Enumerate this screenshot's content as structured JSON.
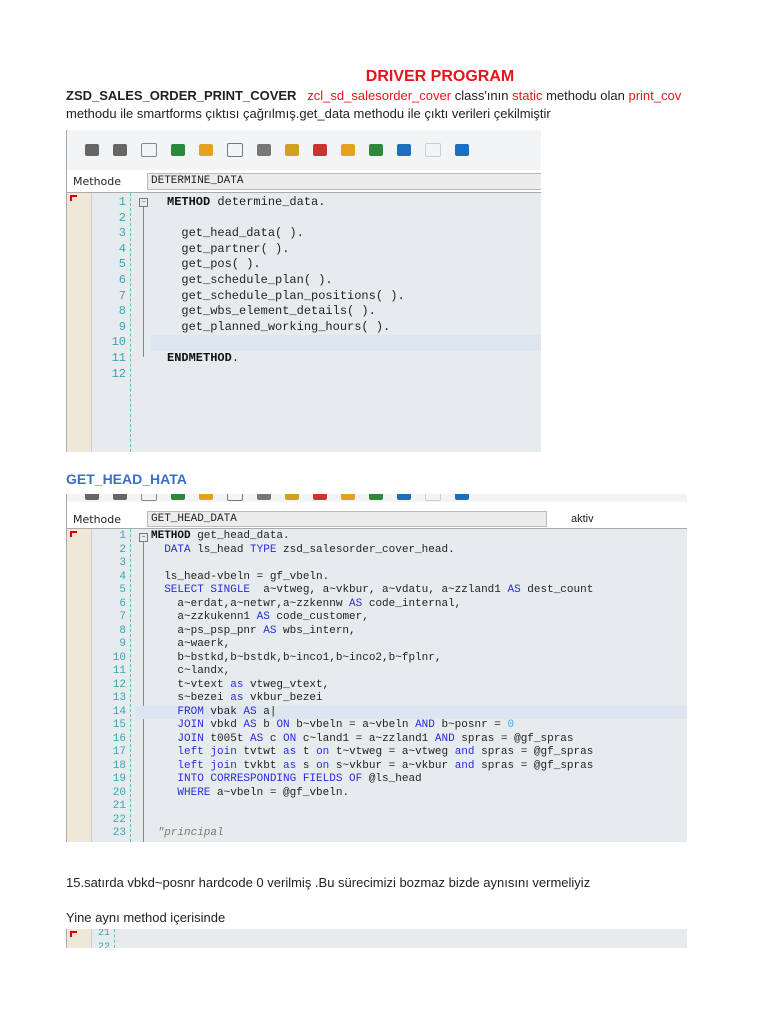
{
  "title": "DRIVER PROGRAM",
  "intro": {
    "program": "ZSD_SALES_ORDER_PRINT_COVER",
    "class_name": "zcl_sd_salesorder_cover",
    "t1": " class'ının ",
    "static": "static",
    "t2": " methodu olan ",
    "method": "print_cov",
    "line2": "methodu ile smartforms çıktısı çağrılmış.get_data methodu ile çıktı verileri çekilmiştir"
  },
  "shot1": {
    "method_label": "Methode",
    "method_value": "DETERMINE_DATA",
    "toolbar_icons": [
      "back-arrow-icon",
      "forward-arrow-icon",
      "display-change-icon",
      "activate-icon",
      "check-icon",
      "where-used-icon",
      "object-list-icon",
      "pretty-printer-icon",
      "breakpoint-icon",
      "navigate-icon",
      "hierarchy-icon",
      "stack-icon",
      "table-icon",
      "info-icon"
    ],
    "lines": [
      {
        "n": "1",
        "t": [
          [
            "k",
            "METHOD"
          ],
          [
            "",
            " determine_data."
          ]
        ]
      },
      {
        "n": "2",
        "t": []
      },
      {
        "n": "3",
        "t": [
          [
            "",
            "  get_head_data( )."
          ]
        ]
      },
      {
        "n": "4",
        "t": [
          [
            "",
            "  get_partner( )."
          ]
        ]
      },
      {
        "n": "5",
        "t": [
          [
            "",
            "  get_pos( )."
          ]
        ]
      },
      {
        "n": "6",
        "t": [
          [
            "",
            "  get_schedule_plan( )."
          ]
        ]
      },
      {
        "n": "7",
        "t": [
          [
            "",
            "  get_schedule_plan_positions( )."
          ]
        ]
      },
      {
        "n": "8",
        "t": [
          [
            "",
            "  get_wbs_element_details( )."
          ]
        ]
      },
      {
        "n": "9",
        "t": [
          [
            "",
            "  get_planned_working_hours( )."
          ]
        ]
      },
      {
        "n": "10",
        "t": [],
        "cur": true
      },
      {
        "n": "11",
        "t": [
          [
            "k",
            "ENDMETHOD"
          ],
          [
            "",
            "."
          ]
        ]
      },
      {
        "n": "12",
        "t": []
      }
    ]
  },
  "heading2": "GET_HEAD_HATA",
  "shot2": {
    "method_label": "Methode",
    "method_value": "GET_HEAD_DATA",
    "status": "aktiv",
    "lines": [
      {
        "n": "1",
        "t": [
          [
            "k",
            "METHOD"
          ],
          [
            "",
            " get_head_data."
          ]
        ]
      },
      {
        "n": "2",
        "t": [
          [
            "b",
            "  DATA"
          ],
          [
            "",
            " ls_head "
          ],
          [
            "b",
            "TYPE"
          ],
          [
            "",
            " zsd_salesorder_cover_head."
          ]
        ]
      },
      {
        "n": "3",
        "t": []
      },
      {
        "n": "4",
        "t": [
          [
            "",
            "  ls_head-vbeln = gf_vbeln."
          ]
        ]
      },
      {
        "n": "5",
        "t": [
          [
            "b",
            "  SELECT SINGLE"
          ],
          [
            "",
            "  a~vtweg, a~vkbur, a~vdatu, a~zzland1 "
          ],
          [
            "b",
            "AS"
          ],
          [
            "",
            " dest_count"
          ]
        ]
      },
      {
        "n": "6",
        "t": [
          [
            "",
            "    a~erdat,a~netwr,a~zzkennw "
          ],
          [
            "b",
            "AS"
          ],
          [
            "",
            " code_internal,"
          ]
        ]
      },
      {
        "n": "7",
        "t": [
          [
            "",
            "    a~zzkukenn1 "
          ],
          [
            "b",
            "AS"
          ],
          [
            "",
            " code_customer,"
          ]
        ]
      },
      {
        "n": "8",
        "t": [
          [
            "",
            "    a~ps_psp_pnr "
          ],
          [
            "b",
            "AS"
          ],
          [
            "",
            " wbs_intern,"
          ]
        ]
      },
      {
        "n": "9",
        "t": [
          [
            "",
            "    a~waerk,"
          ]
        ]
      },
      {
        "n": "10",
        "t": [
          [
            "",
            "    b~bstkd,b~bstdk,b~inco1,b~inco2,b~fplnr,"
          ]
        ]
      },
      {
        "n": "11",
        "t": [
          [
            "",
            "    c~landx,"
          ]
        ]
      },
      {
        "n": "12",
        "t": [
          [
            "",
            "    t~vtext "
          ],
          [
            "b",
            "as"
          ],
          [
            "",
            " vtweg_vtext,"
          ]
        ]
      },
      {
        "n": "13",
        "t": [
          [
            "",
            "    s~bezei "
          ],
          [
            "b",
            "as"
          ],
          [
            "",
            " vkbur_bezei"
          ]
        ]
      },
      {
        "n": "14",
        "t": [
          [
            "b",
            "    FROM"
          ],
          [
            "",
            " vbak "
          ],
          [
            "b",
            "AS"
          ],
          [
            "",
            " a|"
          ]
        ],
        "cur": true
      },
      {
        "n": "15",
        "t": [
          [
            "b",
            "    JOIN"
          ],
          [
            "",
            " vbkd "
          ],
          [
            "b",
            "AS"
          ],
          [
            "",
            " b "
          ],
          [
            "b",
            "ON"
          ],
          [
            "",
            " b~vbeln = a~vbeln "
          ],
          [
            "b",
            "AND"
          ],
          [
            "",
            " b~posnr = "
          ],
          [
            "n",
            "0"
          ]
        ]
      },
      {
        "n": "16",
        "t": [
          [
            "b",
            "    JOIN"
          ],
          [
            "",
            " t005t "
          ],
          [
            "b",
            "AS"
          ],
          [
            "",
            " c "
          ],
          [
            "b",
            "ON"
          ],
          [
            "",
            " c~land1 = a~zzland1 "
          ],
          [
            "b",
            "AND"
          ],
          [
            "",
            " spras = @gf_spras"
          ]
        ]
      },
      {
        "n": "17",
        "t": [
          [
            "b",
            "    left join"
          ],
          [
            "",
            " tvtwt "
          ],
          [
            "b",
            "as"
          ],
          [
            "",
            " t "
          ],
          [
            "b",
            "on"
          ],
          [
            "",
            " t~vtweg = a~vtweg "
          ],
          [
            "b",
            "and"
          ],
          [
            "",
            " spras = @gf_spras"
          ]
        ]
      },
      {
        "n": "18",
        "t": [
          [
            "b",
            "    left join"
          ],
          [
            "",
            " tvkbt "
          ],
          [
            "b",
            "as"
          ],
          [
            "",
            " s "
          ],
          [
            "b",
            "on"
          ],
          [
            "",
            " s~vkbur = a~vkbur "
          ],
          [
            "b",
            "and"
          ],
          [
            "",
            " spras = @gf_spras"
          ]
        ]
      },
      {
        "n": "19",
        "t": [
          [
            "b",
            "    INTO CORRESPONDING FIELDS OF"
          ],
          [
            "",
            " @ls_head"
          ]
        ]
      },
      {
        "n": "20",
        "t": [
          [
            "b",
            "    WHERE"
          ],
          [
            "",
            " a~vbeln = @gf_vbeln."
          ]
        ]
      },
      {
        "n": "21",
        "t": []
      },
      {
        "n": "22",
        "t": []
      },
      {
        "n": "23",
        "t": [
          [
            "c",
            " \"principal"
          ]
        ]
      }
    ]
  },
  "note1": "15.satırda  vbkd~posnr hardcode 0 verilmiş .Bu sürecimizi bozmaz bizde aynısını vermeliyiz",
  "note2": "Yine aynı method içerisinde",
  "shot3": {
    "lines": [
      {
        "n": "21",
        "t": []
      },
      {
        "n": "22",
        "t": []
      }
    ]
  }
}
